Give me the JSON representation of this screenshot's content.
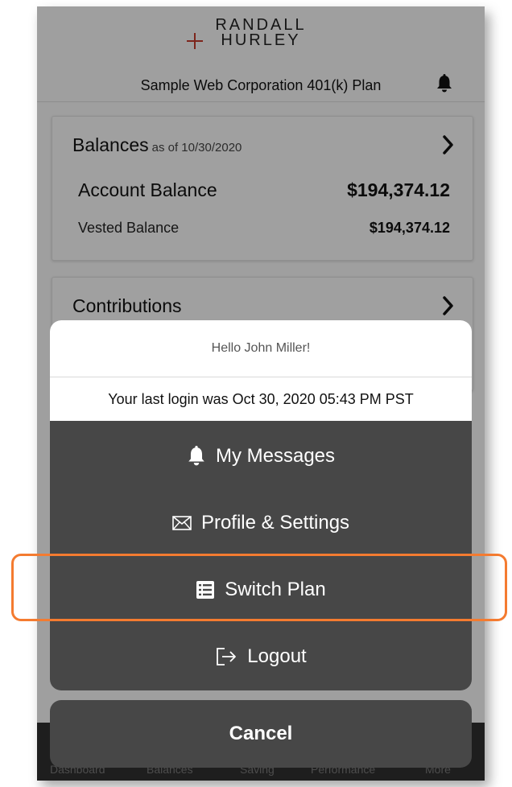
{
  "header": {
    "logo_line1": "RANDALL",
    "logo_line2": "HURLEY",
    "plan_name": "Sample Web Corporation 401(k) Plan",
    "notification_icon": "bell-icon"
  },
  "balances_card": {
    "title": "Balances",
    "as_of": "as of 10/30/2020",
    "account_balance_label": "Account Balance",
    "account_balance_value": "$194,374.12",
    "vested_balance_label": "Vested Balance",
    "vested_balance_value": "$194,374.12"
  },
  "contributions_card": {
    "title": "Contributions"
  },
  "action_sheet": {
    "greeting": "Hello John Miller!",
    "last_login": "Your last login was Oct 30, 2020 05:43 PM PST",
    "items": [
      {
        "label": "My Messages",
        "icon": "bell-icon"
      },
      {
        "label": "Profile & Settings",
        "icon": "envelope-icon"
      },
      {
        "label": "Switch Plan",
        "icon": "list-icon"
      },
      {
        "label": "Logout",
        "icon": "logout-icon"
      }
    ],
    "cancel_label": "Cancel"
  },
  "tab_bar": {
    "tabs": [
      "Dashboard",
      "Balances",
      "Saving",
      "Performance",
      "More"
    ]
  },
  "colors": {
    "highlight": "#f47b30",
    "sheet_bg": "#474747",
    "logo_cross": "#c0392b"
  }
}
